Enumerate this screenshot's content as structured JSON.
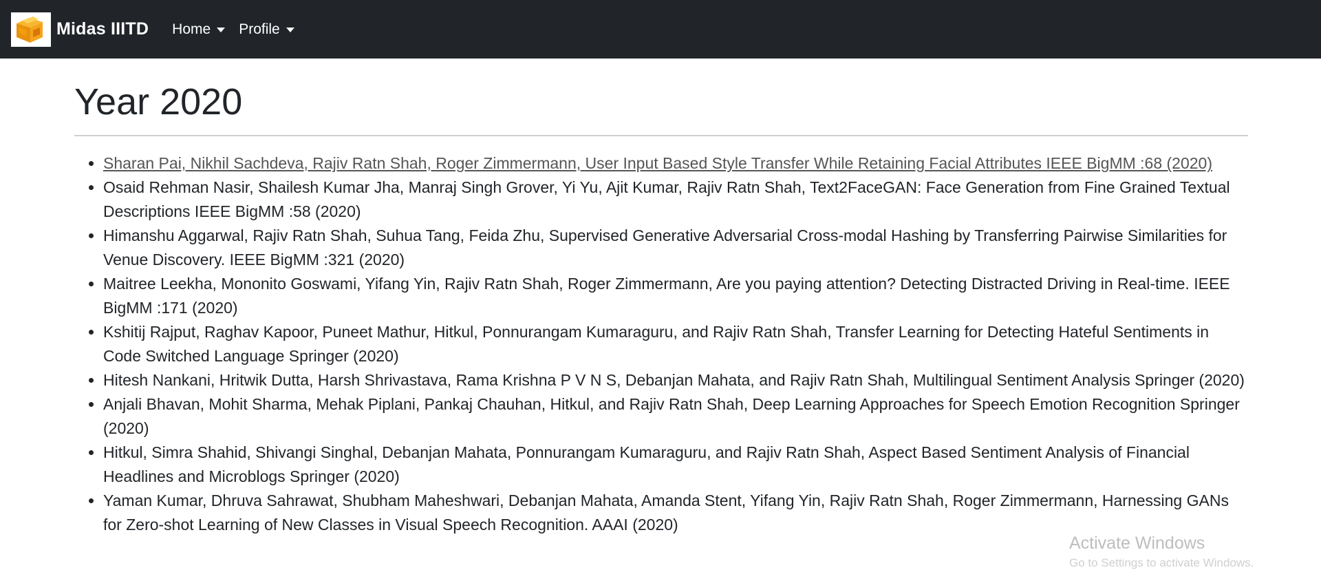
{
  "navbar": {
    "brand": "Midas IIITD",
    "logo_icon": "midas-cube-logo",
    "items": [
      {
        "label": "Home"
      },
      {
        "label": "Profile"
      }
    ]
  },
  "page": {
    "title": "Year 2020"
  },
  "publications": [
    "Sharan Pai, Nikhil Sachdeva, Rajiv Ratn Shah, Roger Zimmermann, User Input Based Style Transfer While Retaining Facial Attributes IEEE BigMM :68 (2020)",
    "Osaid Rehman Nasir, Shailesh Kumar Jha, Manraj Singh Grover, Yi Yu, Ajit Kumar, Rajiv Ratn Shah, Text2FaceGAN: Face Generation from Fine Grained Textual Descriptions IEEE BigMM :58 (2020)",
    "Himanshu Aggarwal, Rajiv Ratn Shah, Suhua Tang, Feida Zhu, Supervised Generative Adversarial Cross-modal Hashing by Transferring Pairwise Similarities for Venue Discovery. IEEE BigMM :321 (2020)",
    "Maitree Leekha, Mononito Goswami, Yifang Yin, Rajiv Ratn Shah, Roger Zimmermann, Are you paying attention? Detecting Distracted Driving in Real-time. IEEE BigMM :171 (2020)",
    "Kshitij Rajput, Raghav Kapoor, Puneet Mathur, Hitkul, Ponnurangam Kumaraguru, and Rajiv Ratn Shah, Transfer Learning for Detecting Hateful Sentiments in Code Switched Language Springer (2020)",
    "Hitesh Nankani, Hritwik Dutta, Harsh Shrivastava, Rama Krishna P V N S, Debanjan Mahata, and Rajiv Ratn Shah, Multilingual Sentiment Analysis Springer (2020)",
    "Anjali Bhavan, Mohit Sharma, Mehak Piplani, Pankaj Chauhan, Hitkul, and Rajiv Ratn Shah, Deep Learning Approaches for Speech Emotion Recognition Springer (2020)",
    "Hitkul, Simra Shahid, Shivangi Singhal, Debanjan Mahata, Ponnurangam Kumaraguru, and Rajiv Ratn Shah, Aspect Based Sentiment Analysis of Financial Headlines and Microblogs Springer (2020)",
    "Yaman Kumar, Dhruva Sahrawat, Shubham Maheshwari, Debanjan Mahata, Amanda Stent, Yifang Yin, Rajiv Ratn Shah, Roger Zimmermann, Harnessing GANs for Zero-shot Learning of New Classes in Visual Speech Recognition. AAAI (2020)"
  ],
  "watermark": {
    "title": "Activate Windows",
    "subtitle": "Go to Settings to activate Windows."
  }
}
